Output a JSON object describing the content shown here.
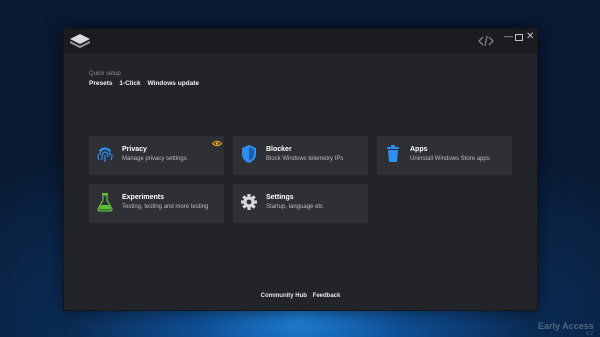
{
  "window": {
    "title_icon": "layers-logo-icon",
    "controls": [
      "minimize",
      "maximize",
      "close"
    ]
  },
  "quick_setup": {
    "label": "Quick setup",
    "links": [
      "Presets",
      "1-Click",
      "Windows update"
    ]
  },
  "cards": [
    {
      "title": "Privacy",
      "desc": "Manage privacy settings",
      "icon": "fingerprint-icon",
      "badge": "eye-icon"
    },
    {
      "title": "Blocker",
      "desc": "Block Windows telemetry IPs",
      "icon": "shield-icon"
    },
    {
      "title": "Apps",
      "desc": "Uninstall Windows Store apps",
      "icon": "trash-icon"
    },
    {
      "title": "Experiments",
      "desc": "Testing, testing and more testing",
      "icon": "flask-icon"
    },
    {
      "title": "Settings",
      "desc": "Startup, language etc",
      "icon": "gear-icon"
    }
  ],
  "footer": {
    "community": "Community Hub",
    "feedback": "Feedback"
  },
  "watermark": {
    "text": "Early Access",
    "version": "0.2"
  },
  "colors": {
    "accent": "#2f8ff0",
    "badge": "#f2a81d",
    "flask": "#5cbf3a",
    "card": "#2e3036",
    "window": "#232429"
  }
}
